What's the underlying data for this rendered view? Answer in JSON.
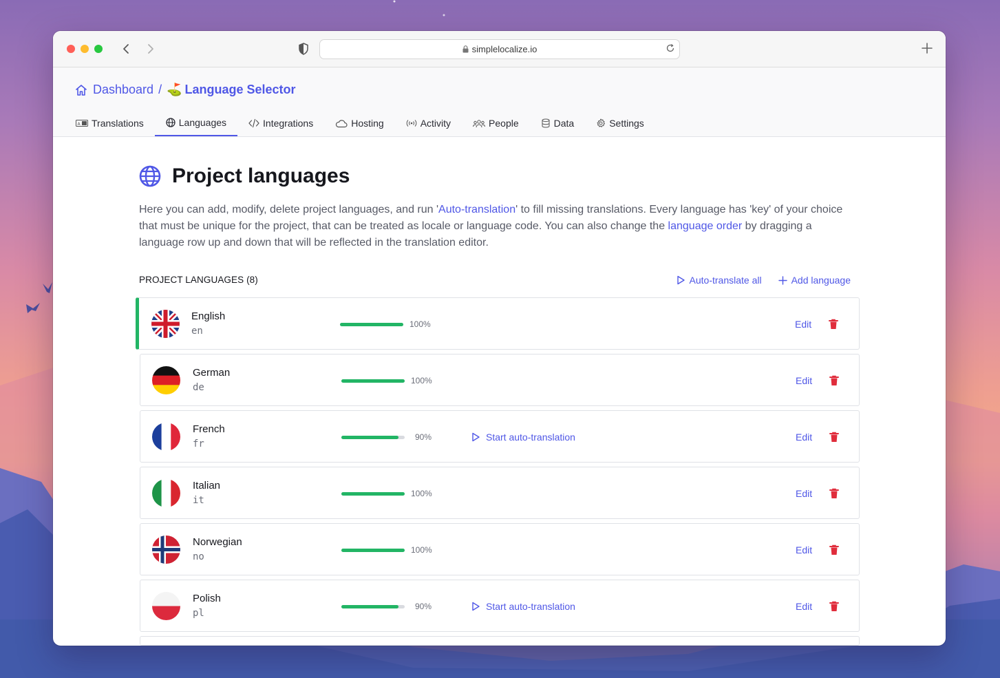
{
  "browser": {
    "url": "simplelocalize.io"
  },
  "breadcrumb": {
    "home_label": "Dashboard",
    "separator": "/",
    "project_emoji": "⛳",
    "project_label": "Language Selector"
  },
  "tabs": [
    {
      "label": "Translations",
      "icon": "translations-icon",
      "active": false
    },
    {
      "label": "Languages",
      "icon": "globe-icon",
      "active": true
    },
    {
      "label": "Integrations",
      "icon": "code-icon",
      "active": false
    },
    {
      "label": "Hosting",
      "icon": "cloud-icon",
      "active": false
    },
    {
      "label": "Activity",
      "icon": "activity-icon",
      "active": false
    },
    {
      "label": "People",
      "icon": "people-icon",
      "active": false
    },
    {
      "label": "Data",
      "icon": "database-icon",
      "active": false
    },
    {
      "label": "Settings",
      "icon": "gear-icon",
      "active": false
    }
  ],
  "page": {
    "title": "Project languages",
    "desc_1": "Here you can add, modify, delete project languages, and run '",
    "desc_link_1": "Auto-translation",
    "desc_2": "' to fill missing translations. Every language has 'key' of your choice that must be unique for the project, that can be treated as locale or language code. You can also change the ",
    "desc_link_2": "language order",
    "desc_3": " by dragging a language row up and down that will be reflected in the translation editor."
  },
  "section": {
    "title": "PROJECT LANGUAGES (8)",
    "auto_translate_all": "Auto-translate all",
    "add_language": "Add language"
  },
  "colors": {
    "accent": "#4f57e6",
    "progress": "#22b565",
    "delete": "#e02d3c"
  },
  "languages": [
    {
      "name": "English",
      "key": "en",
      "progress": 100,
      "pct_label": "100%",
      "auto_label": "",
      "edit_label": "Edit",
      "flag": "uk",
      "selected": true
    },
    {
      "name": "German",
      "key": "de",
      "progress": 100,
      "pct_label": "100%",
      "auto_label": "",
      "edit_label": "Edit",
      "flag": "de",
      "selected": false
    },
    {
      "name": "French",
      "key": "fr",
      "progress": 90,
      "pct_label": "90%",
      "auto_label": "Start auto-translation",
      "edit_label": "Edit",
      "flag": "fr",
      "selected": false
    },
    {
      "name": "Italian",
      "key": "it",
      "progress": 100,
      "pct_label": "100%",
      "auto_label": "",
      "edit_label": "Edit",
      "flag": "it",
      "selected": false
    },
    {
      "name": "Norwegian",
      "key": "no",
      "progress": 100,
      "pct_label": "100%",
      "auto_label": "",
      "edit_label": "Edit",
      "flag": "no",
      "selected": false
    },
    {
      "name": "Polish",
      "key": "pl",
      "progress": 90,
      "pct_label": "90%",
      "auto_label": "Start auto-translation",
      "edit_label": "Edit",
      "flag": "pl",
      "selected": false
    }
  ]
}
